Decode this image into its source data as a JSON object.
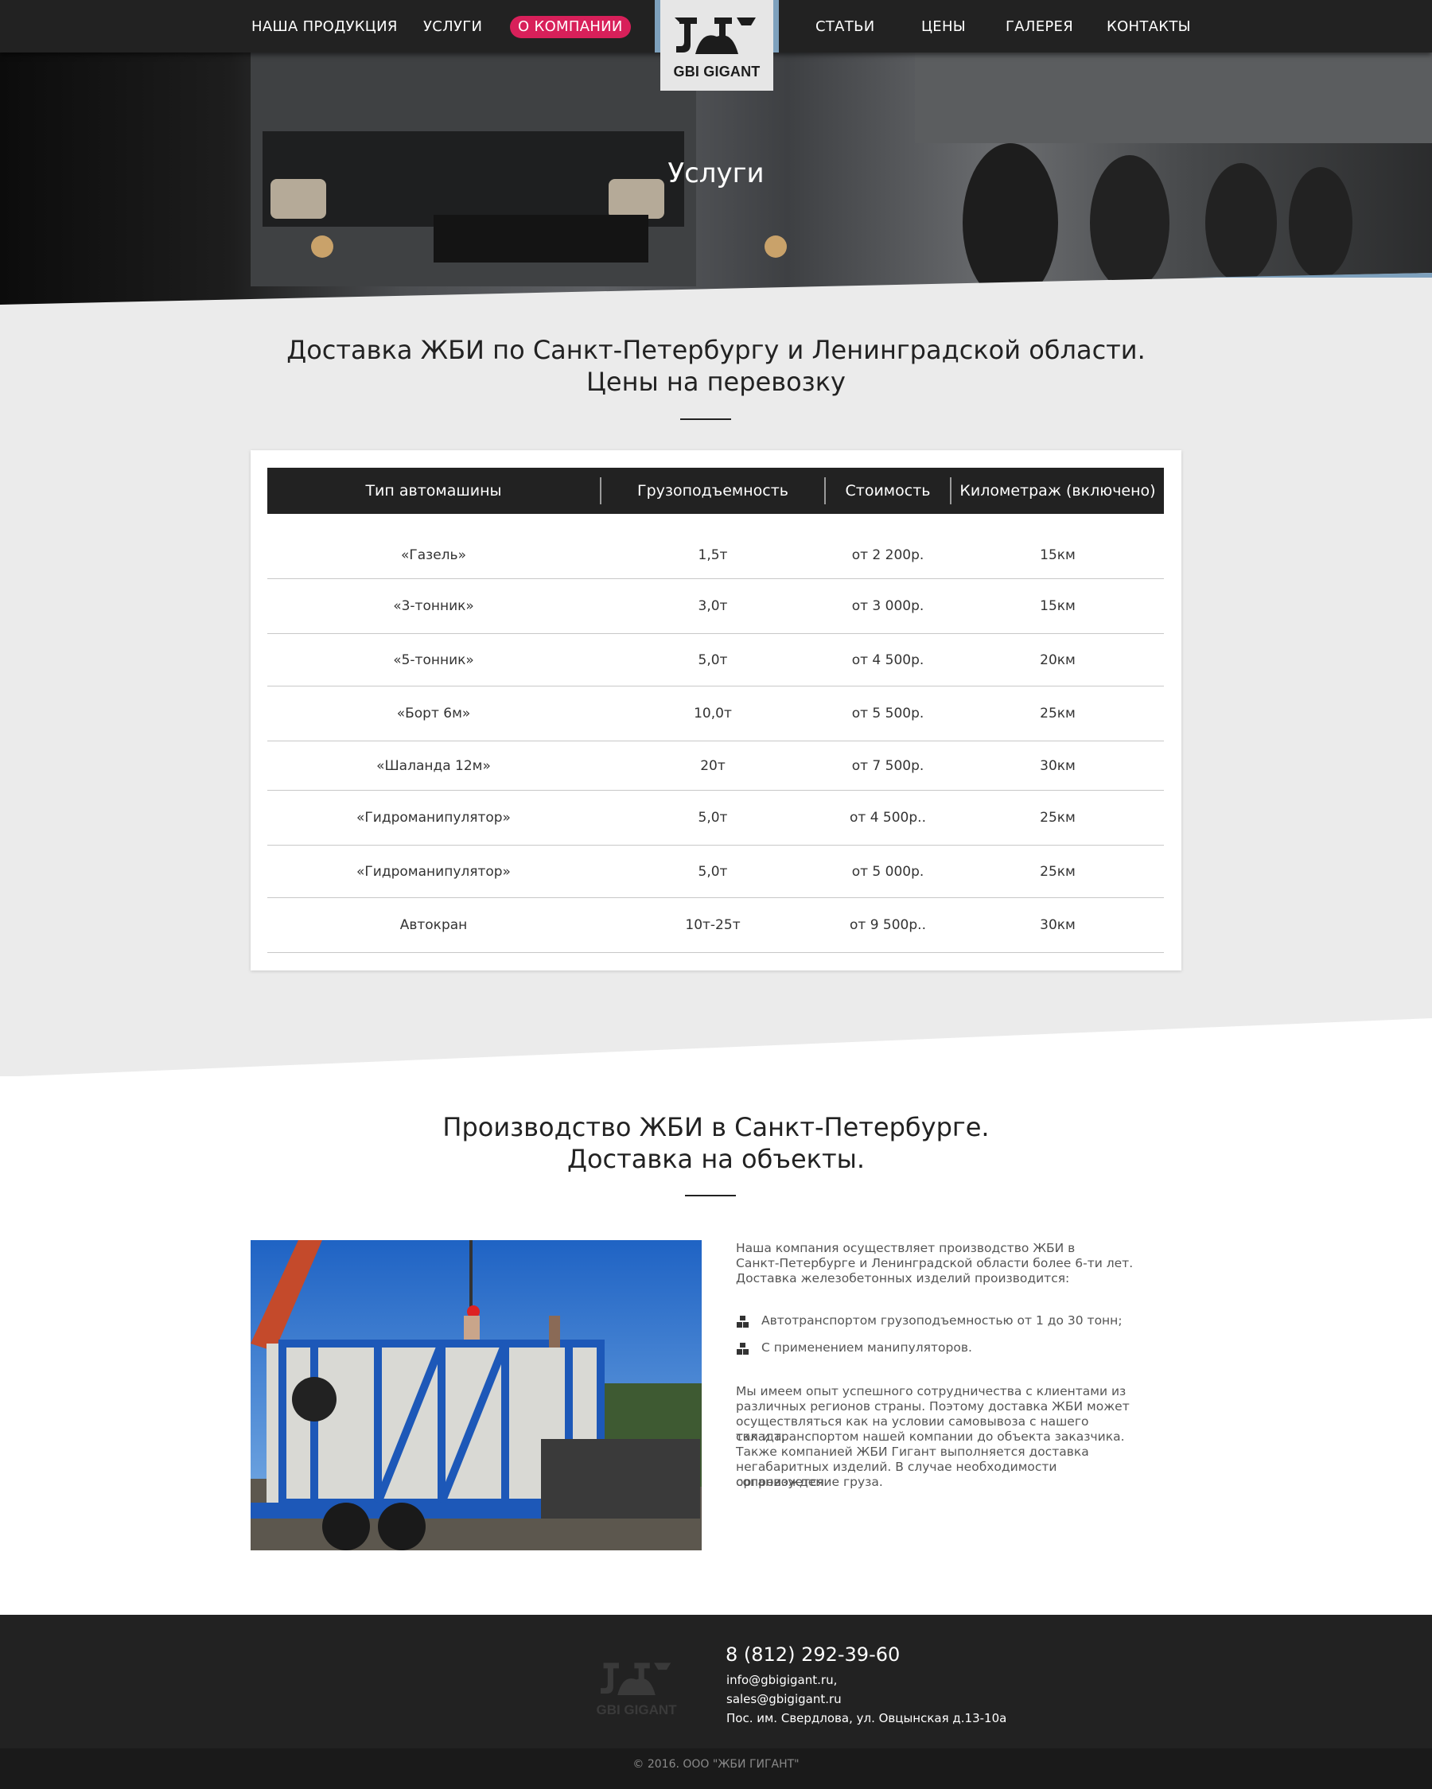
{
  "nav": {
    "left_items": [
      "НАША ПРОДУКЦИЯ",
      "УСЛУГИ",
      "О КОМПАНИИ"
    ],
    "right_items": [
      "СТАТЬИ",
      "ЦЕНЫ",
      "ГАЛЕРЕЯ",
      "КОНТАКТЫ"
    ],
    "active_item": "О КОМПАНИИ",
    "logo_text": "GBI GIGANT"
  },
  "hero": {
    "title": "Услуги"
  },
  "section1": {
    "title_line1": "Доставка ЖБИ по Санкт-Петербургу и Ленинградской области.",
    "title_line2": "Цены на перевозку",
    "table": {
      "headers": [
        "Тип автомашины",
        "Грузоподъемность",
        "Стоимость",
        "Километраж (включено)"
      ],
      "rows": [
        [
          "«Газель»",
          "1,5т",
          "от 2 200р.",
          "15км"
        ],
        [
          "«3-тонник»",
          "3,0т",
          "от 3 000р.",
          "15км"
        ],
        [
          "«5-тонник»",
          "5,0т",
          "от 4 500р.",
          "20км"
        ],
        [
          "«Борт 6м»",
          "10,0т",
          "от 5 500р.",
          "25км"
        ],
        [
          "«Шаланда 12м»",
          "20т",
          "от 7 500р.",
          "30км"
        ],
        [
          "«Гидроманипулятор»",
          "5,0т",
          "от 4 500р..",
          "25км"
        ],
        [
          "«Гидроманипулятор»",
          "5,0т",
          "от 5 000р.",
          "25км"
        ],
        [
          "Автокран",
          "10т-25т",
          "от 9 500р..",
          "30км"
        ]
      ]
    }
  },
  "section2": {
    "title_line1": "Производство ЖБИ в Санкт-Петербурге.",
    "title_line2": "Доставка на объекты.",
    "intro": [
      "Наша компания осуществляет производство ЖБИ в",
      "Санкт-Петербурге и Ленинградской области более 6-ти лет.",
      "Доставка железобетонных изделий производится:"
    ],
    "bullets": [
      "Автотранспортом грузоподъемностью от 1 до 30 тонн;",
      "С применением манипуляторов."
    ],
    "body": [
      "Мы имеем опыт успешного сотрудничества с клиентами из",
      "различных регионов страны. Поэтому доставка ЖБИ может",
      "осуществляться как на условии самовывоза с нашего склада,",
      "так и транспортом нашей компании до объекта заказчика.",
      "Также компанией ЖБИ Гигант выполняется доставка",
      "негабаритных изделий.  В случае необходимости организуется",
      "сопровождение груза."
    ]
  },
  "footer": {
    "logo_text": "GBI GIGANT",
    "phone": "8 (812) 292-39-60",
    "email1": "info@gbigigant.ru,",
    "email2": "sales@gbigigant.ru",
    "address": "Пос. им. Свердлова, ул. Овцынская д.13-10а",
    "copyright": "© 2016. ООО \"ЖБИ ГИГАНТ\""
  },
  "colors": {
    "accent": "#d8205a",
    "dark": "#222222",
    "logo_strip": "#7ea1bd"
  }
}
